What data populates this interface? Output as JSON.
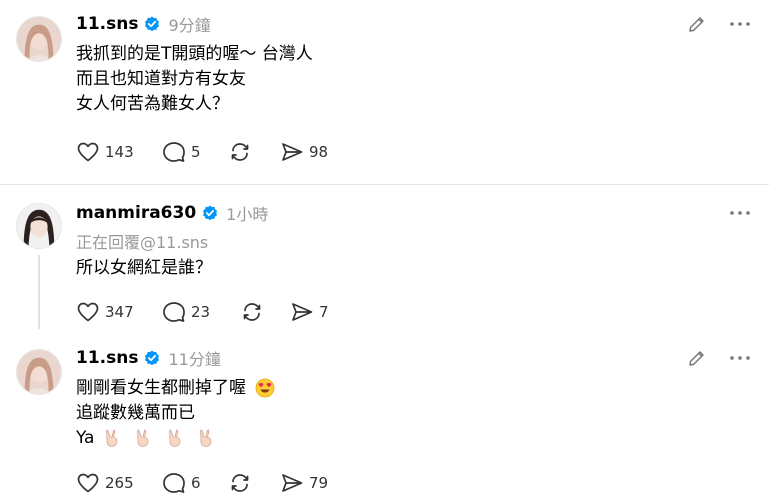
{
  "posts": [
    {
      "username": "11.sns",
      "time": "9分鐘",
      "lines": [
        "我抓到的是T開頭的喔～ 台灣人",
        "而且也知道對方有女友",
        "女人何苦為難女人？"
      ],
      "likes": "143",
      "replies": "5",
      "shares": "98"
    },
    {
      "username": "manmira630",
      "time": "1小時",
      "replying_to": "正在回覆@11.sns",
      "lines": [
        "所以女網紅是誰？"
      ],
      "likes": "347",
      "replies": "23",
      "shares": "7"
    },
    {
      "username": "11.sns",
      "time": "11分鐘",
      "lines": [
        "剛剛看女生都刪掉了喔",
        "追蹤數幾萬而已",
        "Ya"
      ],
      "likes": "265",
      "replies": "6",
      "shares": "79"
    }
  ],
  "colors": {
    "verified": "#0095f6",
    "muted": "#999999",
    "divider": "#e4e4e4"
  },
  "icons": [
    "heart-icon",
    "comment-icon",
    "repost-icon",
    "share-icon",
    "edit-icon",
    "more-icon",
    "verified-icon",
    "heart-eyes-emoji",
    "victory-hand-emoji"
  ]
}
